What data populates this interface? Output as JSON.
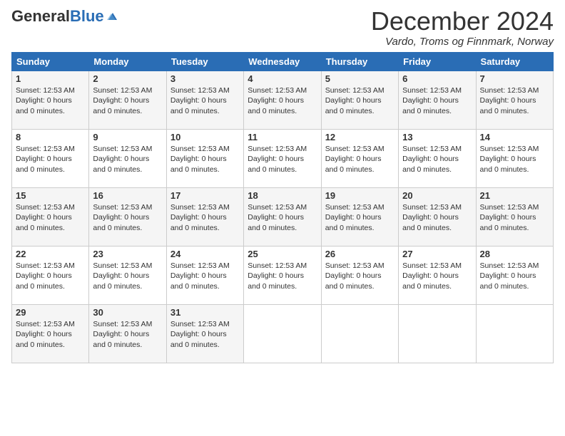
{
  "logo": {
    "general": "General",
    "blue": "Blue"
  },
  "title": "December 2024",
  "location": "Vardo, Troms og Finnmark, Norway",
  "days_of_week": [
    "Sunday",
    "Monday",
    "Tuesday",
    "Wednesday",
    "Thursday",
    "Friday",
    "Saturday"
  ],
  "cell_info": "Sunset: 12:53 AM\nDaylight: 0 hours and 0 minutes.",
  "weeks": [
    [
      {
        "day": "1",
        "info": "Sunset: 12:53 AM\nDaylight: 0 hours\nand 0 minutes."
      },
      {
        "day": "2",
        "info": "Sunset: 12:53 AM\nDaylight: 0 hours\nand 0 minutes."
      },
      {
        "day": "3",
        "info": "Sunset: 12:53 AM\nDaylight: 0 hours\nand 0 minutes."
      },
      {
        "day": "4",
        "info": "Sunset: 12:53 AM\nDaylight: 0 hours\nand 0 minutes."
      },
      {
        "day": "5",
        "info": "Sunset: 12:53 AM\nDaylight: 0 hours\nand 0 minutes."
      },
      {
        "day": "6",
        "info": "Sunset: 12:53 AM\nDaylight: 0 hours\nand 0 minutes."
      },
      {
        "day": "7",
        "info": "Sunset: 12:53 AM\nDaylight: 0 hours\nand 0 minutes."
      }
    ],
    [
      {
        "day": "8",
        "info": "Sunset: 12:53 AM\nDaylight: 0 hours\nand 0 minutes."
      },
      {
        "day": "9",
        "info": "Sunset: 12:53 AM\nDaylight: 0 hours\nand 0 minutes."
      },
      {
        "day": "10",
        "info": "Sunset: 12:53 AM\nDaylight: 0 hours\nand 0 minutes."
      },
      {
        "day": "11",
        "info": "Sunset: 12:53 AM\nDaylight: 0 hours\nand 0 minutes."
      },
      {
        "day": "12",
        "info": "Sunset: 12:53 AM\nDaylight: 0 hours\nand 0 minutes."
      },
      {
        "day": "13",
        "info": "Sunset: 12:53 AM\nDaylight: 0 hours\nand 0 minutes."
      },
      {
        "day": "14",
        "info": "Sunset: 12:53 AM\nDaylight: 0 hours\nand 0 minutes."
      }
    ],
    [
      {
        "day": "15",
        "info": "Sunset: 12:53 AM\nDaylight: 0 hours\nand 0 minutes."
      },
      {
        "day": "16",
        "info": "Sunset: 12:53 AM\nDaylight: 0 hours\nand 0 minutes."
      },
      {
        "day": "17",
        "info": "Sunset: 12:53 AM\nDaylight: 0 hours\nand 0 minutes."
      },
      {
        "day": "18",
        "info": "Sunset: 12:53 AM\nDaylight: 0 hours\nand 0 minutes."
      },
      {
        "day": "19",
        "info": "Sunset: 12:53 AM\nDaylight: 0 hours\nand 0 minutes."
      },
      {
        "day": "20",
        "info": "Sunset: 12:53 AM\nDaylight: 0 hours\nand 0 minutes."
      },
      {
        "day": "21",
        "info": "Sunset: 12:53 AM\nDaylight: 0 hours\nand 0 minutes."
      }
    ],
    [
      {
        "day": "22",
        "info": "Sunset: 12:53 AM\nDaylight: 0 hours\nand 0 minutes."
      },
      {
        "day": "23",
        "info": "Sunset: 12:53 AM\nDaylight: 0 hours\nand 0 minutes."
      },
      {
        "day": "24",
        "info": "Sunset: 12:53 AM\nDaylight: 0 hours\nand 0 minutes."
      },
      {
        "day": "25",
        "info": "Sunset: 12:53 AM\nDaylight: 0 hours\nand 0 minutes."
      },
      {
        "day": "26",
        "info": "Sunset: 12:53 AM\nDaylight: 0 hours\nand 0 minutes."
      },
      {
        "day": "27",
        "info": "Sunset: 12:53 AM\nDaylight: 0 hours\nand 0 minutes."
      },
      {
        "day": "28",
        "info": "Sunset: 12:53 AM\nDaylight: 0 hours\nand 0 minutes."
      }
    ],
    [
      {
        "day": "29",
        "info": "Sunset: 12:53 AM\nDaylight: 0 hours\nand 0 minutes."
      },
      {
        "day": "30",
        "info": "Sunset: 12:53 AM\nDaylight: 0 hours\nand 0 minutes."
      },
      {
        "day": "31",
        "info": "Sunset: 12:53 AM\nDaylight: 0 hours\nand 0 minutes."
      },
      {
        "day": "",
        "info": ""
      },
      {
        "day": "",
        "info": ""
      },
      {
        "day": "",
        "info": ""
      },
      {
        "day": "",
        "info": ""
      }
    ]
  ]
}
